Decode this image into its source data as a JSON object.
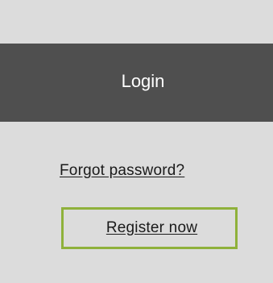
{
  "login": {
    "label": "Login"
  },
  "links": {
    "forgot_password": "Forgot password?",
    "register_now": "Register now"
  },
  "colors": {
    "background": "#dcdcdc",
    "login_bar": "#4f4f4f",
    "login_text": "#ffffff",
    "link_text": "#1a1a1a",
    "focus_border": "#8fb13b"
  }
}
